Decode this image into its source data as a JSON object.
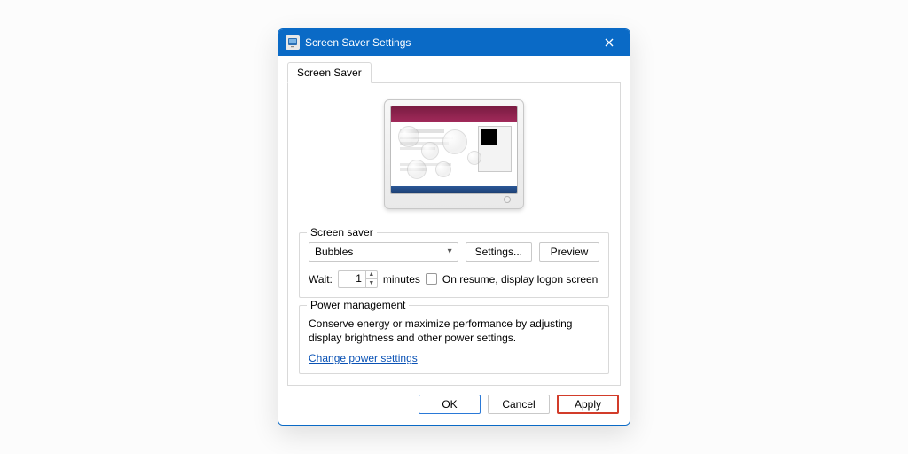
{
  "window": {
    "title": "Screen Saver Settings"
  },
  "tab": {
    "label": "Screen Saver"
  },
  "screenSaver": {
    "groupTitle": "Screen saver",
    "selected": "Bubbles",
    "settingsBtn": "Settings...",
    "previewBtn": "Preview"
  },
  "wait": {
    "label": "Wait:",
    "value": "1",
    "unit": "minutes",
    "resumeLabel": "On resume, display logon screen",
    "resumeChecked": false
  },
  "power": {
    "groupTitle": "Power management",
    "text": "Conserve energy or maximize performance by adjusting display brightness and other power settings.",
    "link": "Change power settings"
  },
  "footer": {
    "ok": "OK",
    "cancel": "Cancel",
    "apply": "Apply"
  }
}
